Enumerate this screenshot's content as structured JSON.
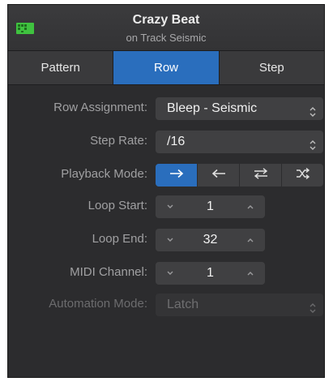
{
  "header": {
    "title": "Crazy Beat",
    "subtitle": "on Track Seismic",
    "icon": "track-region-icon",
    "icon_color": "#3fc23f"
  },
  "tabs": [
    {
      "label": "Pattern",
      "active": false
    },
    {
      "label": "Row",
      "active": true
    },
    {
      "label": "Step",
      "active": false
    }
  ],
  "fields": {
    "row_assignment": {
      "label": "Row Assignment:",
      "value": "Bleep - Seismic"
    },
    "step_rate": {
      "label": "Step Rate:",
      "value": "/16"
    },
    "playback_mode": {
      "label": "Playback Mode:",
      "options": [
        "forward-arrow-icon",
        "reverse-arrow-icon",
        "ping-pong-icon",
        "random-shuffle-icon"
      ],
      "selected": "forward-arrow-icon"
    },
    "loop_start": {
      "label": "Loop Start:",
      "value": "1"
    },
    "loop_end": {
      "label": "Loop End:",
      "value": "32"
    },
    "midi_channel": {
      "label": "MIDI Channel:",
      "value": "1"
    },
    "automation_mode": {
      "label": "Automation Mode:",
      "value": "Latch",
      "disabled": true
    }
  },
  "colors": {
    "accent": "#2a6ebd",
    "panel_bg": "#2c2c2e",
    "control_bg": "#404042",
    "label_text": "#a0a0a2"
  }
}
